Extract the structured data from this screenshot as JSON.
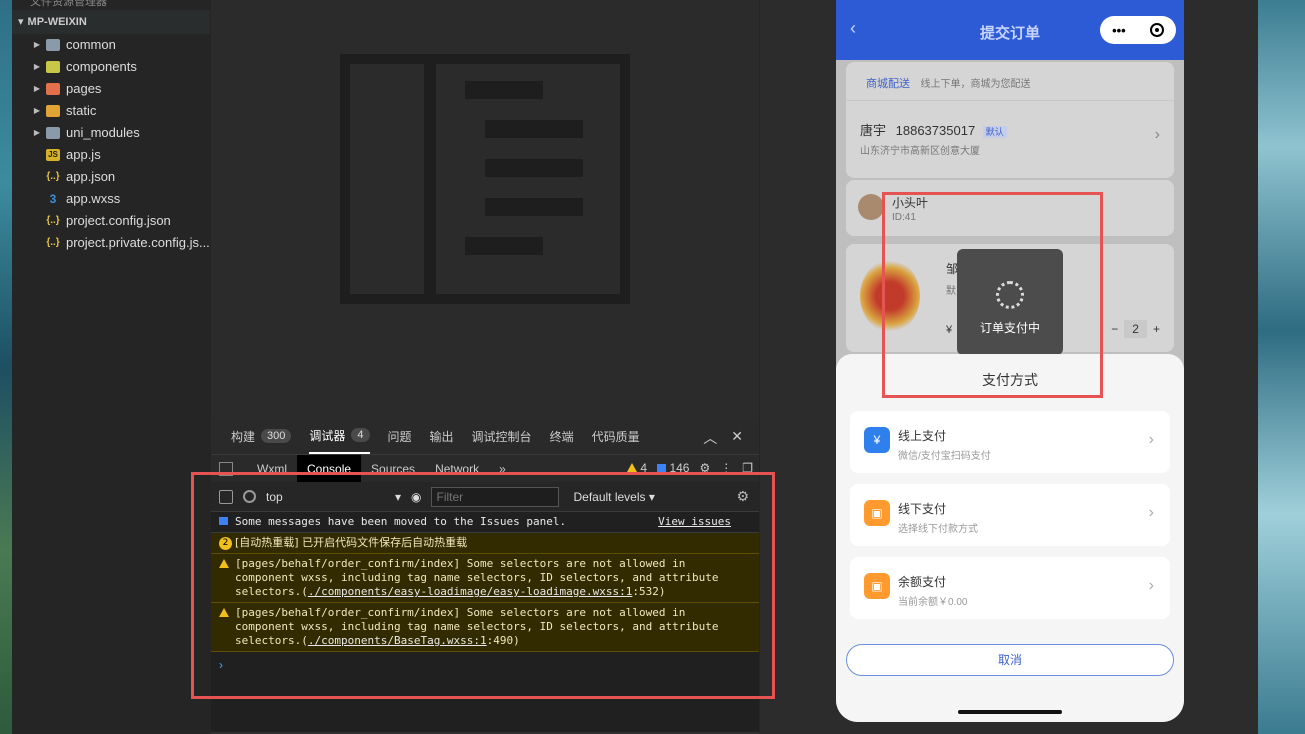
{
  "sidebar": {
    "top_cut_text": "文件资源管理器",
    "section_title": "MP-WEIXIN",
    "items": [
      {
        "label": "common",
        "icon": "folder-icon",
        "type": "folder"
      },
      {
        "label": "components",
        "icon": "folder-components-icon",
        "type": "folder"
      },
      {
        "label": "pages",
        "icon": "folder-pages-icon",
        "type": "folder"
      },
      {
        "label": "static",
        "icon": "folder-static-icon",
        "type": "folder"
      },
      {
        "label": "uni_modules",
        "icon": "folder-icon",
        "type": "folder"
      },
      {
        "label": "app.js",
        "icon": "js-file-icon",
        "type": "file",
        "badge": "JS"
      },
      {
        "label": "app.json",
        "icon": "json-file-icon",
        "type": "file",
        "badge": "{..}"
      },
      {
        "label": "app.wxss",
        "icon": "css-file-icon",
        "type": "file",
        "badge": "3"
      },
      {
        "label": "project.config.json",
        "icon": "json-file-icon",
        "type": "file",
        "badge": "{..}"
      },
      {
        "label": "project.private.config.js...",
        "icon": "json-file-icon",
        "type": "file",
        "badge": "{..}"
      }
    ]
  },
  "devtools": {
    "top_tabs": [
      {
        "label": "构建",
        "badge": "300"
      },
      {
        "label": "调试器",
        "badge": "4",
        "active": true
      },
      {
        "label": "问题"
      },
      {
        "label": "输出"
      },
      {
        "label": "调试控制台"
      },
      {
        "label": "终端"
      },
      {
        "label": "代码质量"
      }
    ],
    "controls": {
      "collapse": "︿",
      "close": "✕"
    },
    "panel_tabs": [
      "Wxml",
      "Console",
      "Sources",
      "Network"
    ],
    "more": "»",
    "warn_count": "4",
    "msg_count": "146",
    "console_bar": {
      "context": "top",
      "filter_placeholder": "Filter",
      "levels": "Default levels ▾"
    },
    "messages": {
      "info": "Some messages have been moved to the Issues panel.",
      "view_issues": "View issues",
      "hotreload_badge": "2",
      "hotreload": "[自动热重载] 已开启代码文件保存后自动热重载",
      "warn1_text": "[pages/behalf/order_confirm/index] Some selectors are not allowed in component wxss, including tag name selectors, ID selectors, and attribute selectors.(",
      "warn1_link": "./components/easy-loadimage/easy-loadimage.wxss:1",
      "warn1_tail": ":532)",
      "warn2_text": "[pages/behalf/order_confirm/index] Some selectors are not allowed in component wxss, including tag name selectors, ID selectors, and attribute selectors.(",
      "warn2_link": "./components/BaseTag.wxss:1",
      "warn2_tail": ":490)"
    },
    "prompt": "›"
  },
  "phone": {
    "back": "‹",
    "title": "提交订单",
    "capsule_dots": "•••",
    "delivery_tab": "商城配送",
    "delivery_desc": "线上下单，商城为您配送",
    "address_name": "唐宇",
    "address_phone": "18863735017",
    "address_tag": "默认",
    "address_detail": "山东济宁市高新区创意大厦",
    "user_name": "小头叶",
    "user_id": "ID:41",
    "product_name": "邹",
    "product_sub": "默",
    "product_price": "¥",
    "qty_minus": "−",
    "qty": "2",
    "qty_plus": "+",
    "toast": "订单支付中",
    "sheet_title": "支付方式",
    "pay_methods": [
      {
        "title": "线上支付",
        "sub": "微信/支付宝扫码支付",
        "color": "#2f80ed"
      },
      {
        "title": "线下支付",
        "sub": "选择线下付款方式",
        "color": "#ff9a2e"
      },
      {
        "title": "余额支付",
        "sub": "当前余额￥0.00",
        "color": "#ff9a2e"
      }
    ],
    "cancel": "取消",
    "chevron": "›"
  }
}
